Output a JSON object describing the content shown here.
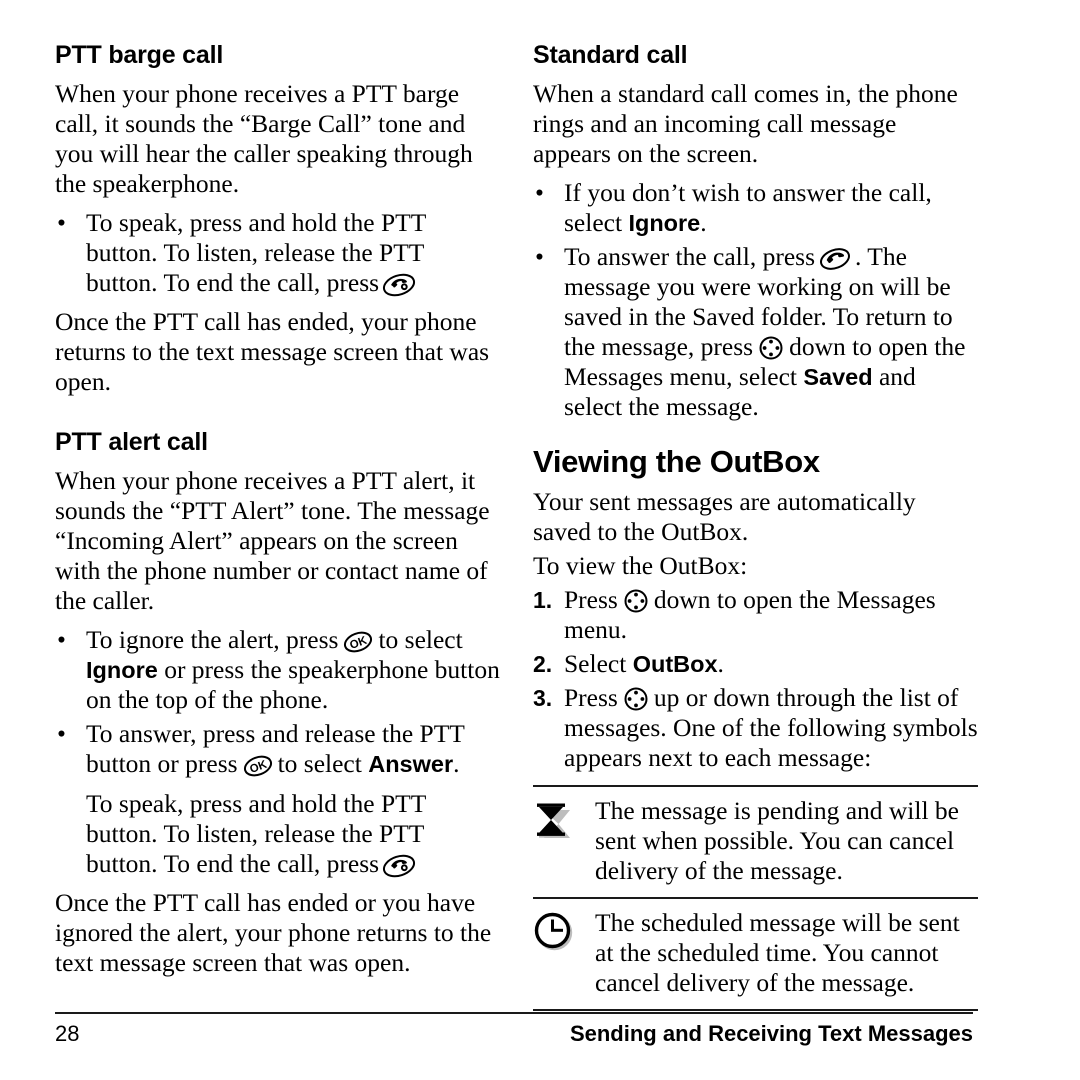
{
  "page": {
    "number": "28",
    "chapter_title": "Sending and Receiving Text Messages"
  },
  "icons": {
    "end_call": "end-call-key-icon",
    "ok": "ok-key-icon",
    "send": "send-call-key-icon",
    "nav": "navigation-key-icon",
    "hourglass": "hourglass-icon",
    "clock": "clock-icon"
  },
  "left_column": {
    "section1": {
      "heading": "PTT barge call",
      "intro": "When your phone receives a PTT barge call, it sounds the “Barge Call” tone and you will hear the caller speaking through the speakerphone.",
      "bullet1_a": "To speak, press and hold the PTT button. To listen, release the PTT button. To end the call, press",
      "closing": "Once the PTT call has ended, your phone returns to the text message screen that was open."
    },
    "section2": {
      "heading": "PTT alert call",
      "intro": "When your phone receives a PTT alert, it sounds the “PTT Alert” tone. The message “Incoming Alert” appears on the screen with the phone number or contact name of the caller.",
      "bullet1_a": "To ignore the alert, press",
      "bullet1_b": "to select",
      "bullet1_bold": "Ignore",
      "bullet1_c": "or press the speakerphone button on the top of the phone.",
      "bullet2_a": "To answer, press and release the PTT button or press",
      "bullet2_b": "to select",
      "bullet2_bold": "Answer",
      "bullet2_c": ".",
      "bullet2_sub": "To speak, press and hold the PTT button. To listen, release the PTT button. To end the call, press",
      "closing": "Once the PTT call has ended or you have ignored the alert, your phone returns to the text message screen that was open."
    }
  },
  "right_column": {
    "section1": {
      "heading": "Standard call",
      "intro": "When a standard call comes in, the phone rings and an incoming call message appears on the screen.",
      "bullet1_a": "If you don’t wish to answer the call, select",
      "bullet1_bold": "Ignore",
      "bullet1_b": ".",
      "bullet2_a": "To answer the call, press",
      "bullet2_b": ". The message you were working on will be saved in the Saved folder. To return to the message, press",
      "bullet2_c": "down to open the Messages menu, select",
      "bullet2_bold": "Saved",
      "bullet2_d": "and select the message."
    },
    "section2": {
      "heading": "Viewing the OutBox",
      "intro": "Your sent messages are automatically saved to the OutBox.",
      "lead_in": "To view the OutBox:",
      "steps": [
        {
          "number": "1.",
          "text_a": "Press",
          "text_b": "down to open the Messages menu."
        },
        {
          "number": "2.",
          "text_a": "Select",
          "bold": "OutBox",
          "text_b": "."
        },
        {
          "number": "3.",
          "text_a": "Press",
          "text_b": "up or down through the list of messages. One of the following symbols appears next to each message:"
        }
      ],
      "symbol_rows": [
        {
          "icon": "hourglass-icon",
          "text": "The message is pending and will be sent when possible. You can cancel delivery of the message."
        },
        {
          "icon": "clock-icon",
          "text": "The scheduled message will be sent at the scheduled time. You cannot cancel delivery of the message."
        }
      ]
    }
  }
}
